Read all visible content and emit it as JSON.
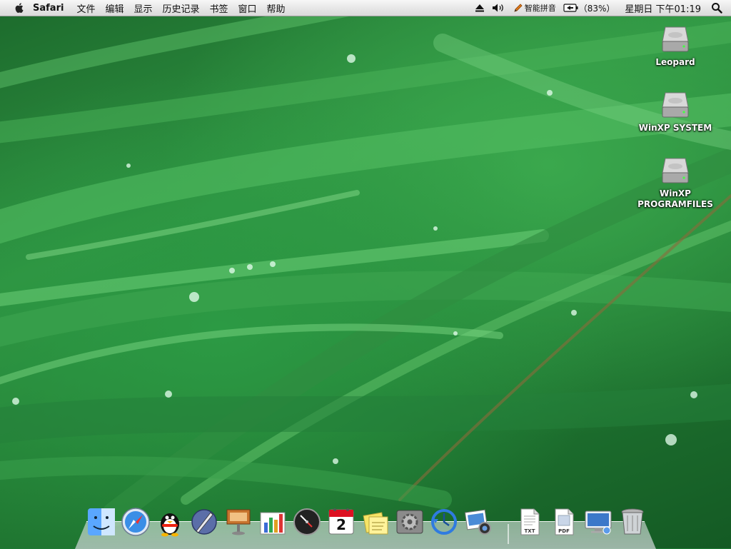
{
  "menubar": {
    "app_name": "Safari",
    "menus": [
      "文件",
      "编辑",
      "显示",
      "历史记录",
      "书签",
      "窗口",
      "帮助"
    ],
    "input_method": "智能拼音",
    "battery": "（83%）",
    "clock": "星期日 下午01:19"
  },
  "desktop_icons": [
    {
      "label": "Leopard"
    },
    {
      "label": "WinXP SYSTEM"
    },
    {
      "label": "WinXP PROGRAMFILES"
    }
  ],
  "dock": {
    "documents": [
      "TXT",
      "PDF"
    ],
    "calendar_day": "2"
  },
  "colors": {
    "menubar_bg": "#e8e8e8",
    "wallpaper_green": "#2f9342",
    "text_shadow": "#000000"
  }
}
